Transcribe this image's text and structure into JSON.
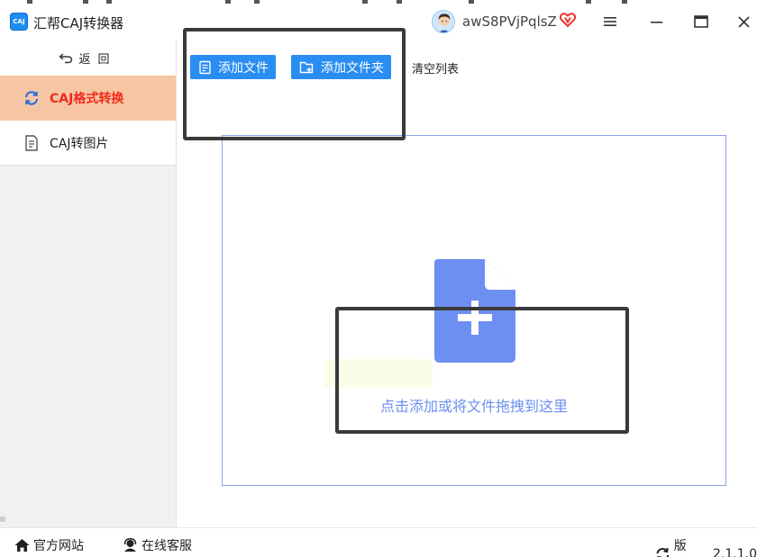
{
  "titlebar": {
    "app_logo_text": "CAJ",
    "app_title": "汇帮CAJ转换器",
    "user_name": "awS8PVjPqlsZ",
    "vip_icon": "heart-v-icon",
    "controls": [
      "menu-icon",
      "minimize-icon",
      "maximize-icon",
      "close-icon"
    ]
  },
  "sidebar": {
    "back_label": "返回",
    "items": [
      {
        "label": "CAJ格式转换",
        "icon": "refresh-icon",
        "active": true
      },
      {
        "label": "CAJ转图片",
        "icon": "document-icon",
        "active": false
      }
    ]
  },
  "toolbar": {
    "add_file_label": "添加文件",
    "add_folder_label": "添加文件夹",
    "clear_list_label": "清空列表"
  },
  "dropzone": {
    "hint": "点击添加或将文件拖拽到这里"
  },
  "footer": {
    "website_label": "官方网站",
    "support_label": "在线客服",
    "version_prefix": "版本：",
    "version": "2.1.1.0"
  },
  "colors": {
    "primary": "#2a8df2",
    "active_bg": "#f6c6a4",
    "active_text": "#f02a1a",
    "drop_icon": "#6e8ff2",
    "highlight_box": "#3a3a3a"
  }
}
